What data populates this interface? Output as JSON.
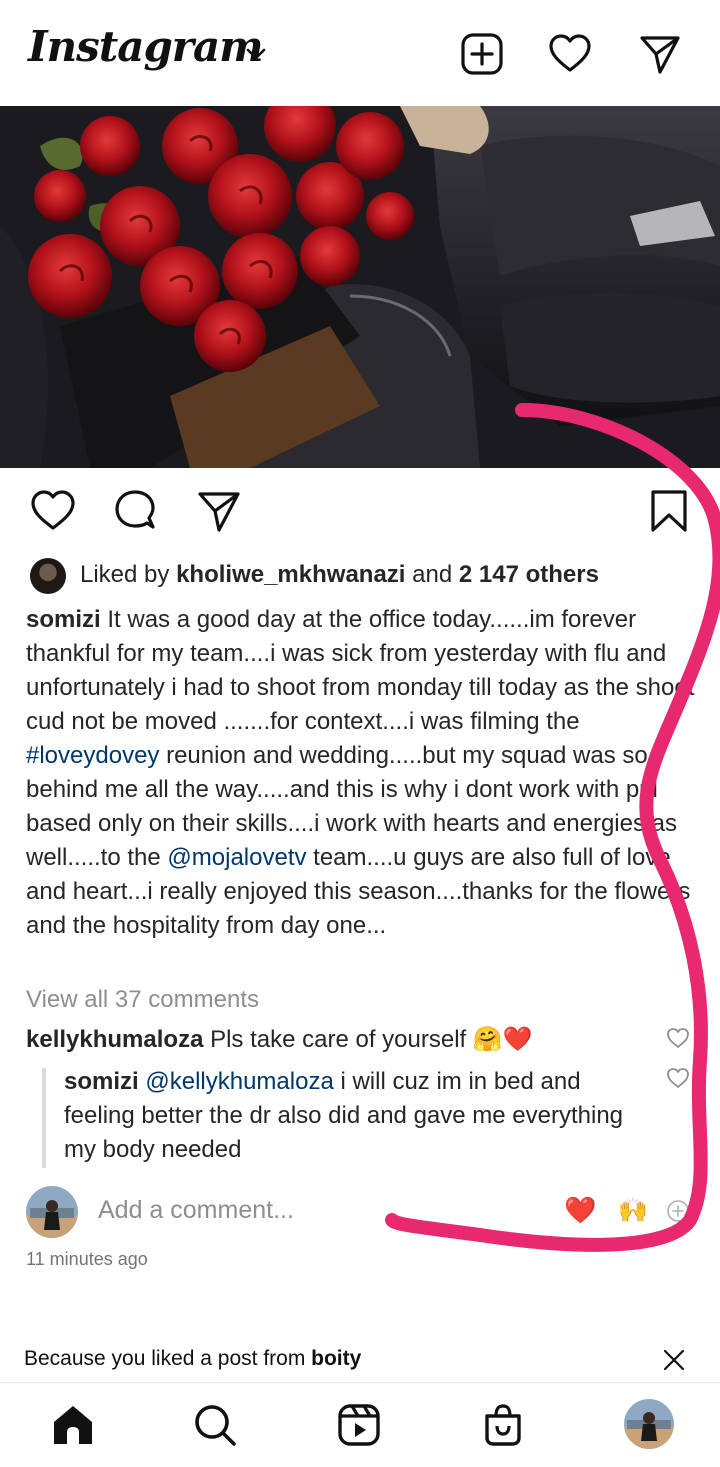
{
  "header": {
    "logo": "Instagram",
    "icons": [
      "chevron-down-icon",
      "new-post-icon",
      "heart-icon",
      "direct-message-icon"
    ]
  },
  "post": {
    "actions": [
      "like-icon",
      "comment-icon",
      "share-icon",
      "save-icon"
    ],
    "likes": {
      "prefix": "Liked by ",
      "user": "kholiwe_mkhwanazi",
      "middle": " and ",
      "others": "2 147 others"
    },
    "caption": {
      "username": "somizi",
      "text_1": " It was a good day at the office today......im forever thankful for my team....i was sick from yesterday with flu and unfortunately i had to shoot from monday till today as the shoot cud not be moved .......for context....i was filming the ",
      "hashtag": "#loveydovey",
      "text_2": " reunion and wedding.....but my squad was so behind me all the way.....and this is why i dont work with ppl based only on their skills....i work with hearts and energies as well.....to the ",
      "mention": "@mojalovetv",
      "text_3": " team....u guys are also full of love and heart...i really enjoyed this season....thanks for the flowers and the hospitality from day one..."
    },
    "view_all_comments": "View all 37 comments",
    "comments": [
      {
        "username": "kellykhumaloza",
        "text": " Pls take care of yourself 🤗❤️"
      }
    ],
    "replies": [
      {
        "username": "somizi",
        "mention": "@kellykhumaloza",
        "text": " i will cuz im in bed and feeling better the dr also did and gave me everything my body needed"
      }
    ],
    "add_comment_placeholder": "Add a comment...",
    "quick_reactions": [
      "❤️",
      "🙌"
    ],
    "timestamp": "11 minutes ago"
  },
  "suggestion": {
    "prefix": "Because you liked a post from ",
    "user": "boity"
  },
  "bottom_nav": [
    "home-icon",
    "search-icon",
    "reels-icon",
    "shop-icon",
    "profile-avatar"
  ],
  "colors": {
    "link": "#00376b",
    "secondary_text": "#8e8e8e",
    "annotation_pink": "#e8286f"
  }
}
